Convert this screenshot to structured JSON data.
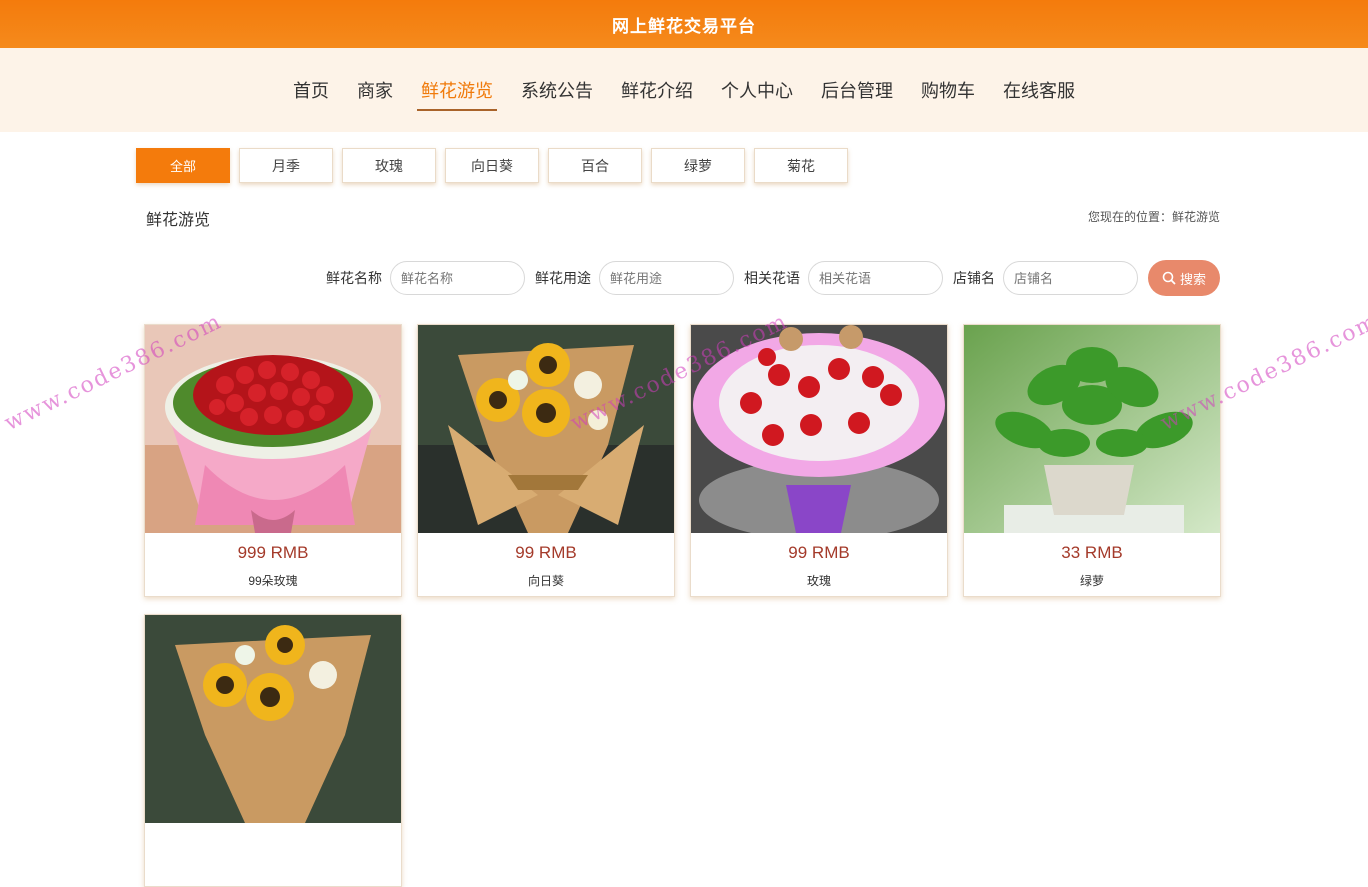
{
  "header": {
    "title": "网上鲜花交易平台"
  },
  "nav": {
    "items": [
      "首页",
      "商家",
      "鲜花游览",
      "系统公告",
      "鲜花介绍",
      "个人中心",
      "后台管理",
      "购物车",
      "在线客服"
    ],
    "active_index": 2
  },
  "categories": {
    "items": [
      "全部",
      "月季",
      "玫瑰",
      "向日葵",
      "百合",
      "绿萝",
      "菊花"
    ],
    "active_index": 0
  },
  "section": {
    "title": "鲜花游览",
    "location": "您现在的位置：鲜花游览"
  },
  "search": {
    "name_label": "鲜花名称",
    "name_placeholder": "鲜花名称",
    "usage_label": "鲜花用途",
    "usage_placeholder": "鲜花用途",
    "language_label": "相关花语",
    "language_placeholder": "相关花语",
    "shop_label": "店铺名",
    "shop_placeholder": "店铺名",
    "button_label": "搜索"
  },
  "products": [
    {
      "price": "999 RMB",
      "name": "99朵玫瑰",
      "icon": "rose-bouquet-photo"
    },
    {
      "price": "99 RMB",
      "name": "向日葵",
      "icon": "sunflower-bouquet-photo"
    },
    {
      "price": "99 RMB",
      "name": "玫瑰",
      "icon": "rose-teddy-bouquet-photo"
    },
    {
      "price": "33 RMB",
      "name": "绿萝",
      "icon": "pothos-plant-photo"
    },
    {
      "price": "",
      "name": "",
      "icon": "sunflower-bouquet-photo"
    }
  ],
  "watermark": {
    "text": "www.code386.com"
  },
  "colors": {
    "accent": "#f47b0c",
    "price": "#a43a2a",
    "search_button": "#e8896b"
  }
}
